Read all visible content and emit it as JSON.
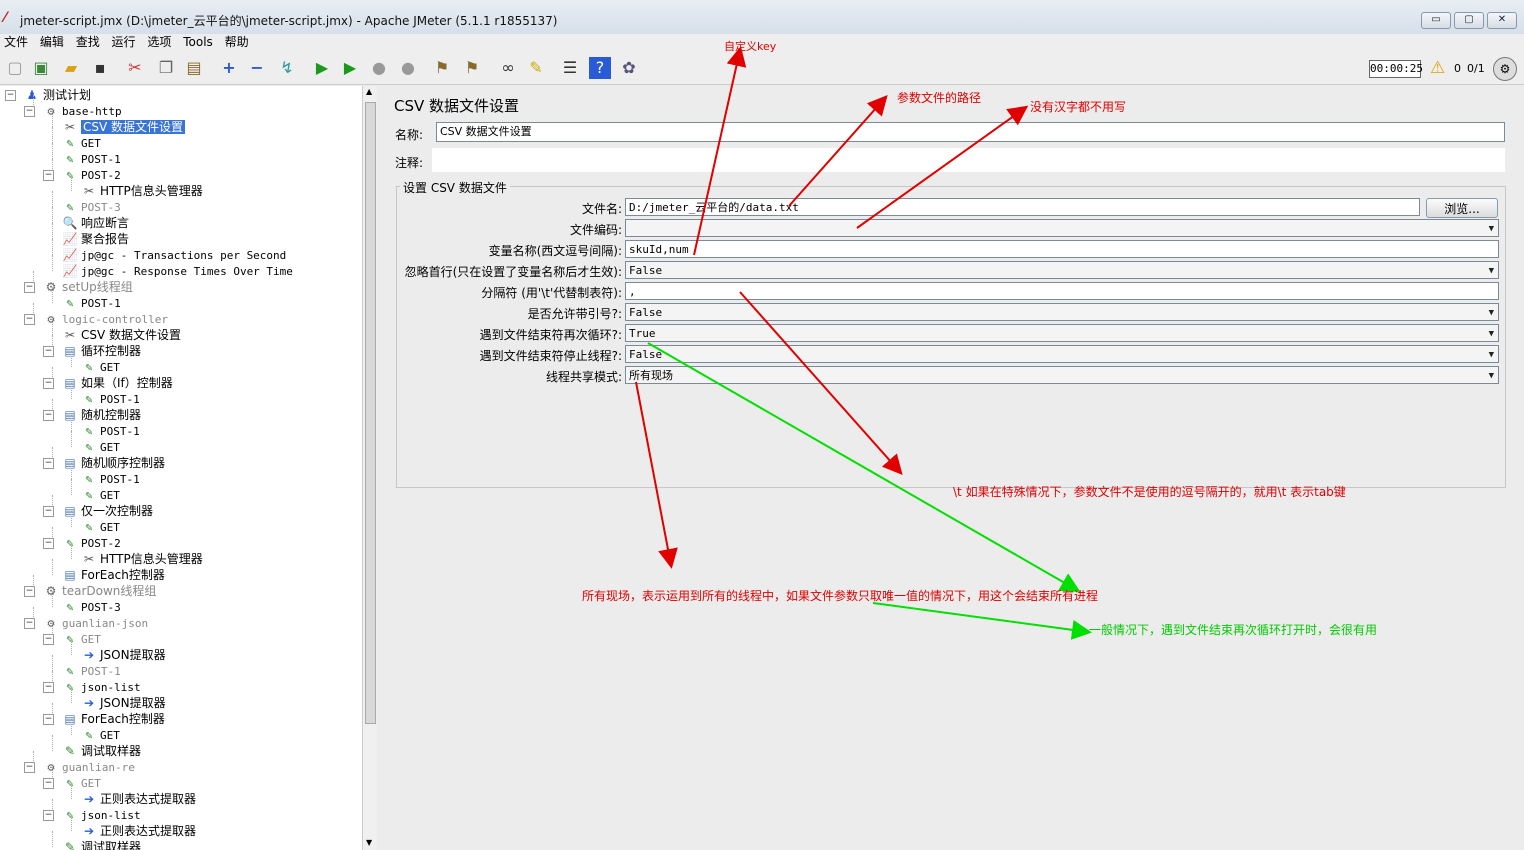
{
  "window": {
    "title": "jmeter-script.jmx (D:\\jmeter_云平台的\\jmeter-script.jmx) - Apache JMeter (5.1.1 r1855137)",
    "controls": [
      "▭",
      "▢",
      "✕"
    ]
  },
  "menu": [
    "文件",
    "编辑",
    "查找",
    "运行",
    "选项",
    "Tools",
    "帮助"
  ],
  "toolbar": {
    "icons": [
      "new-icon",
      "templates-icon",
      "open-icon",
      "save-icon",
      "cut-icon",
      "copy-icon",
      "paste-icon",
      "expand-icon",
      "collapse-icon",
      "toggle-icon",
      "start-icon",
      "start-no-pause-icon",
      "stop-icon",
      "shutdown-icon",
      "clear-icon",
      "clear-all-icon",
      "search-icon",
      "reset-search-icon",
      "function-helper-icon",
      "help-icon",
      "remote-icon"
    ],
    "timer": "00:00:25",
    "warning_count": "0",
    "threads": "0/1"
  },
  "tree": [
    {
      "label": "测试计划",
      "icon": "♟"
    },
    {
      "label": "base-http",
      "icon": "⚙"
    },
    {
      "label": "CSV 数据文件设置",
      "icon": "✂",
      "selected": true
    },
    {
      "label": "GET",
      "icon": "✎"
    },
    {
      "label": "POST-1",
      "icon": "✎"
    },
    {
      "label": "POST-2",
      "icon": "✎"
    },
    {
      "label": "HTTP信息头管理器",
      "icon": "✂"
    },
    {
      "label": "POST-3",
      "icon": "✎",
      "disabled": true
    },
    {
      "label": "响应断言",
      "icon": "🔍"
    },
    {
      "label": "聚合报告",
      "icon": "📈"
    },
    {
      "label": "jp@gc - Transactions per Second",
      "icon": "📈"
    },
    {
      "label": "jp@gc - Response Times Over Time",
      "icon": "📈"
    },
    {
      "label": "setUp线程组",
      "icon": "⚙",
      "disabled": true
    },
    {
      "label": "POST-1",
      "icon": "✎"
    },
    {
      "label": "logic-controller",
      "icon": "⚙",
      "disabled": true
    },
    {
      "label": "CSV 数据文件设置",
      "icon": "✂"
    },
    {
      "label": "循环控制器",
      "icon": "▤"
    },
    {
      "label": "GET",
      "icon": "✎"
    },
    {
      "label": "如果（If）控制器",
      "icon": "▤"
    },
    {
      "label": "POST-1",
      "icon": "✎"
    },
    {
      "label": "随机控制器",
      "icon": "▤"
    },
    {
      "label": "POST-1",
      "icon": "✎"
    },
    {
      "label": "GET",
      "icon": "✎"
    },
    {
      "label": "随机顺序控制器",
      "icon": "▤"
    },
    {
      "label": "POST-1",
      "icon": "✎"
    },
    {
      "label": "GET",
      "icon": "✎"
    },
    {
      "label": "仅一次控制器",
      "icon": "▤"
    },
    {
      "label": "GET",
      "icon": "✎"
    },
    {
      "label": "POST-2",
      "icon": "✎"
    },
    {
      "label": "HTTP信息头管理器",
      "icon": "✂"
    },
    {
      "label": "ForEach控制器",
      "icon": "▤"
    },
    {
      "label": "tearDown线程组",
      "icon": "⚙",
      "disabled": true
    },
    {
      "label": "POST-3",
      "icon": "✎"
    },
    {
      "label": "guanlian-json",
      "icon": "⚙",
      "disabled": true
    },
    {
      "label": "GET",
      "icon": "✎",
      "disabled": true
    },
    {
      "label": "JSON提取器",
      "icon": "➔"
    },
    {
      "label": "POST-1",
      "icon": "✎",
      "disabled": true
    },
    {
      "label": "json-list",
      "icon": "✎"
    },
    {
      "label": "JSON提取器",
      "icon": "➔"
    },
    {
      "label": "ForEach控制器",
      "icon": "▤"
    },
    {
      "label": "GET",
      "icon": "✎"
    },
    {
      "label": "调试取样器",
      "icon": "✎"
    },
    {
      "label": "guanlian-re",
      "icon": "⚙",
      "disabled": true
    },
    {
      "label": "GET",
      "icon": "✎",
      "disabled": true
    },
    {
      "label": "正则表达式提取器",
      "icon": "➔"
    },
    {
      "label": "json-list",
      "icon": "✎"
    },
    {
      "label": "正则表达式提取器",
      "icon": "➔"
    },
    {
      "label": "调试取样器",
      "icon": "✎"
    }
  ],
  "panel": {
    "title": "CSV 数据文件设置",
    "name_label": "名称:",
    "name_value": "CSV 数据文件设置",
    "comment_label": "注释:",
    "comment_value": "",
    "group_title": "设置 CSV 数据文件",
    "fields": [
      {
        "label": "文件名:",
        "value": "D:/jmeter_云平台的/data.txt",
        "kind": "text"
      },
      {
        "label": "文件编码:",
        "value": "",
        "kind": "combo"
      },
      {
        "label": "变量名称(西文逗号间隔):",
        "value": "skuId,num",
        "kind": "text"
      },
      {
        "label": "忽略首行(只在设置了变量名称后才生效):",
        "value": "False",
        "kind": "combo"
      },
      {
        "label": "分隔符 (用'\\t'代替制表符):",
        "value": ",",
        "kind": "text"
      },
      {
        "label": "是否允许带引号?:",
        "value": "False",
        "kind": "combo"
      },
      {
        "label": "遇到文件结束符再次循环?:",
        "value": "True",
        "kind": "combo"
      },
      {
        "label": "遇到文件结束符停止线程?:",
        "value": "False",
        "kind": "combo"
      },
      {
        "label": "线程共享模式:",
        "value": "所有现场",
        "kind": "combo"
      }
    ],
    "browse_label": "浏览..."
  },
  "annotations": [
    {
      "text": "自定义key",
      "color": "#e00000"
    },
    {
      "text": "参数文件的路径",
      "color": "#e00000"
    },
    {
      "text": "没有汉字都不用写",
      "color": "#e00000"
    },
    {
      "text": "\\t 如果在特殊情况下，参数文件不是使用的逗号隔开的，就用\\t   表示tab键",
      "color": "#e00000"
    },
    {
      "text": "所有现场，表示运用到所有的线程中，如果文件参数只取唯一值的情况下，用这个会结束所有进程",
      "color": "#e00000"
    },
    {
      "text": "一般情况下，遇到文件结束再次循环打开时，会很有用",
      "color": "#00cc00"
    }
  ],
  "colors": {
    "red": "#e00000",
    "green": "#00e000",
    "selection": "#3875d7"
  }
}
